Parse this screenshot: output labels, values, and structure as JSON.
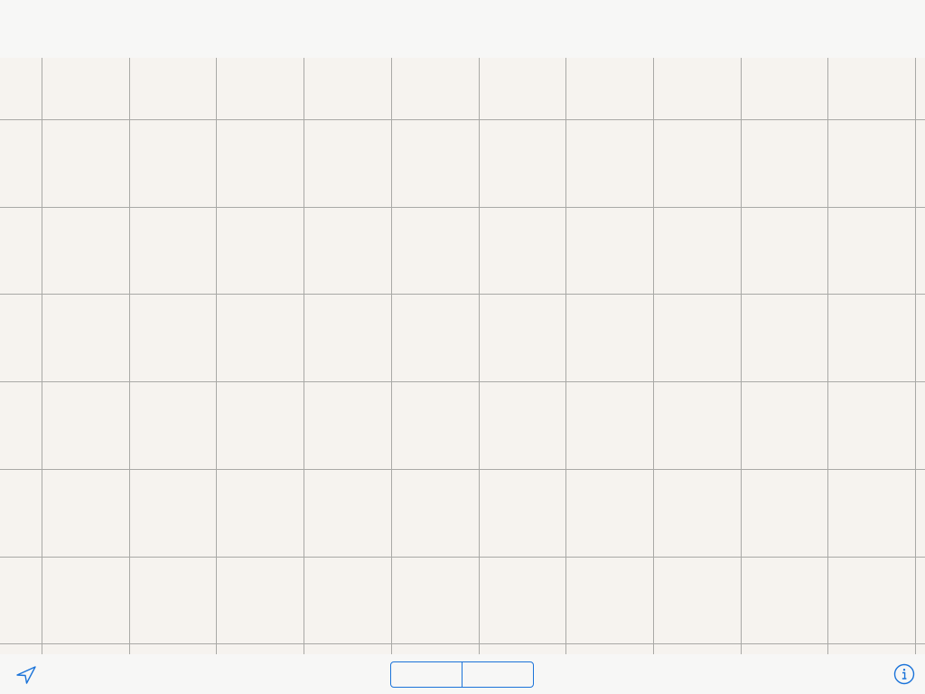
{
  "colors": {
    "accent": "#1a73d9",
    "map_background": "#f6f3ef",
    "grid_line": "#a9a9a6",
    "bar_background": "#f7f7f6"
  },
  "map": {
    "view": "grid-placeholder"
  },
  "bottom_bar": {
    "locate_icon": "location-arrow-icon",
    "segments": [
      {
        "label": ""
      },
      {
        "label": ""
      }
    ],
    "info_icon": "info-icon"
  }
}
